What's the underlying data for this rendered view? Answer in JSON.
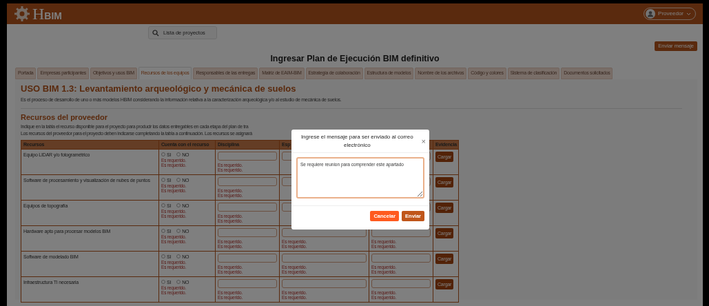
{
  "header": {
    "logo": {
      "initial": "H",
      "rest": "BIM"
    },
    "user": "Proveedor",
    "search": "Lista de proyectos"
  },
  "send_button": "Enviar mensaje",
  "title": "Ingresar Plan de Ejecución BIM definitivo",
  "tabs": [
    {
      "label": "Portada",
      "selected": false
    },
    {
      "label": "Empresas participantes",
      "selected": false
    },
    {
      "label": "Objetivos y usos BIM",
      "selected": false
    },
    {
      "label": "Recursos de los equipos",
      "selected": true
    },
    {
      "label": "Responsables de las entregas",
      "selected": false
    },
    {
      "label": "Matriz de EAIM-BIM",
      "selected": false
    },
    {
      "label": "Estrategia de colaboración",
      "selected": false
    },
    {
      "label": "Estructura de modelos",
      "selected": false
    },
    {
      "label": "Nombre de los archivos",
      "selected": false
    },
    {
      "label": "Código y colores",
      "selected": false
    },
    {
      "label": "Sistema de clasificación",
      "selected": false
    },
    {
      "label": "Documentos solicitados",
      "selected": false
    }
  ],
  "use_heading": "USO BIM 1.3: Levantamiento arqueológico y mecánica de suelos",
  "use_description": "Es el proceso de desarrollo de uno o más modelos HBIM considerando la información relativa a la caracterización arqueológica y/o al estudio de mecánica de suelos.",
  "section_heading": "Recursos del proveedor",
  "section_lines": [
    "Indique en la tabla el recurso disponible para el proyecto para producir los datos entregables en cada etapa del plan de tra",
    "Los recursos del proveedor para el proyecto deben indicarse completando la tabla a continuación. Los recursos se asignará"
  ],
  "table": {
    "columns": [
      "Recursos",
      "Cuenta con el recurso",
      "Disciplina",
      "Esp",
      "Evidencia"
    ],
    "rows": [
      {
        "resource": "Equipo LIDAR y/o fotogramétrico",
        "options": [
          {
            "label": "SI",
            "selected": false
          },
          {
            "label": "NO",
            "selected": false
          }
        ],
        "option_messages": [
          "Es requerido.",
          "Es requerido."
        ],
        "fields": [
          {
            "messages": [
              "Es requerido.",
              "Es requerido."
            ]
          }
        ],
        "button": "Cargar"
      },
      {
        "resource": "Software de procesamiento y visualización de nubes de puntos",
        "options": [
          {
            "label": "SI",
            "selected": false
          },
          {
            "label": "NO",
            "selected": false
          }
        ],
        "option_messages": [
          "Es requerido.",
          "Es requerido."
        ],
        "fields": [
          {
            "messages": [
              "Es requerido.",
              "Es requerido."
            ]
          }
        ],
        "button": "Cargar"
      },
      {
        "resource": "Equipos de topografía",
        "options": [
          {
            "label": "SI",
            "selected": false
          },
          {
            "label": "NO",
            "selected": false
          }
        ],
        "option_messages": [
          "Es requerido.",
          "Es requerido."
        ],
        "fields": [
          {
            "messages": [
              "Es requerido.",
              "Es requerido."
            ]
          }
        ],
        "button": "Cargar"
      },
      {
        "resource": "Hardware apto para procesar modelos BIM",
        "options": [
          {
            "label": "SI",
            "selected": false
          },
          {
            "label": "NO",
            "selected": false
          }
        ],
        "option_messages": [
          "Es requerido.",
          "Es requerido."
        ],
        "fields": [
          {
            "messages": [
              "Es requerido.",
              "Es requerido."
            ]
          },
          {
            "messages": [
              "Es requerido.",
              "Es requerido."
            ]
          },
          {
            "messages": [
              "Es requerido.",
              "Es requerido."
            ]
          }
        ],
        "button": "Cargar"
      },
      {
        "resource": "Software de modelado BIM",
        "options": [
          {
            "label": "SI",
            "selected": false
          },
          {
            "label": "NO",
            "selected": false
          }
        ],
        "option_messages": [
          "Es requerido.",
          "Es requerido."
        ],
        "fields": [
          {
            "messages": [
              "Es requerido.",
              "Es requerido."
            ]
          },
          {
            "messages": [
              "Es requerido.",
              "Es requerido."
            ]
          },
          {
            "messages": [
              "Es requerido.",
              "Es requerido."
            ]
          }
        ],
        "button": "Cargar"
      },
      {
        "resource": "Infraestructura TI necesaria",
        "options": [
          {
            "label": "SI",
            "selected": false
          },
          {
            "label": "NO",
            "selected": false
          }
        ],
        "option_messages": [
          "Es requerido.",
          "Es requerido."
        ],
        "fields": [
          {
            "messages": [
              "Es requerido.",
              "Es requerido."
            ]
          },
          {
            "messages": [
              "Es requerido.",
              "Es requerido."
            ]
          },
          {
            "messages": [
              "Es requerido.",
              "Es requerido."
            ]
          }
        ],
        "button": "Cargar"
      }
    ]
  },
  "modal": {
    "title": "Ingrese el mensaje para ser enviado al correo electrónico",
    "close": "×",
    "message": "Se requiere reunion para comprender este apartado",
    "cancel": "Cancelar",
    "send": "Enviar"
  }
}
